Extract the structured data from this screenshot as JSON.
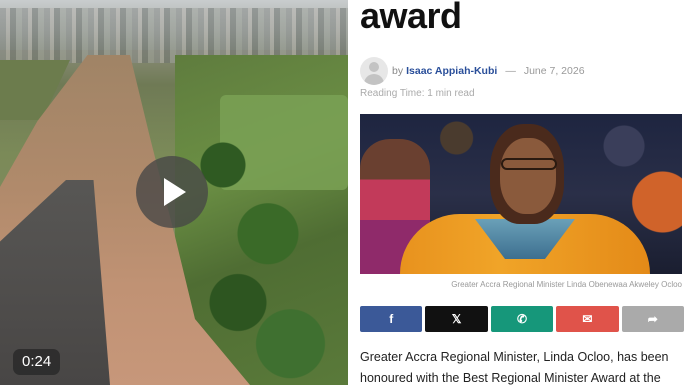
{
  "video": {
    "duration_label": "0:24",
    "play_icon": "play-icon"
  },
  "article": {
    "headline": "award",
    "author_prefix": "by",
    "author": "Isaac Appiah-Kubi",
    "separator": "—",
    "date": "June 7, 2026",
    "reading_time": "Reading Time: 1 min read",
    "photo_caption": "Greater Accra Regional Minister Linda Obenewaa Akweley Ocloo",
    "share_buttons": [
      {
        "icon": "facebook-icon",
        "glyph": "f"
      },
      {
        "icon": "x-icon",
        "glyph": "𝕏"
      },
      {
        "icon": "whatsapp-icon",
        "glyph": "✆"
      },
      {
        "icon": "email-icon",
        "glyph": "✉"
      },
      {
        "icon": "share-icon",
        "glyph": "➦"
      }
    ],
    "body_text": "Greater Accra Regional Minister, Linda Ocloo, has been honoured with the Best Regional Minister Award at the"
  },
  "colors": {
    "facebook": "#3b5998",
    "x": "#111111",
    "whatsapp": "#16977a",
    "email": "#e0534a",
    "share": "#aaaaaa",
    "author_link": "#2a4f9a"
  }
}
